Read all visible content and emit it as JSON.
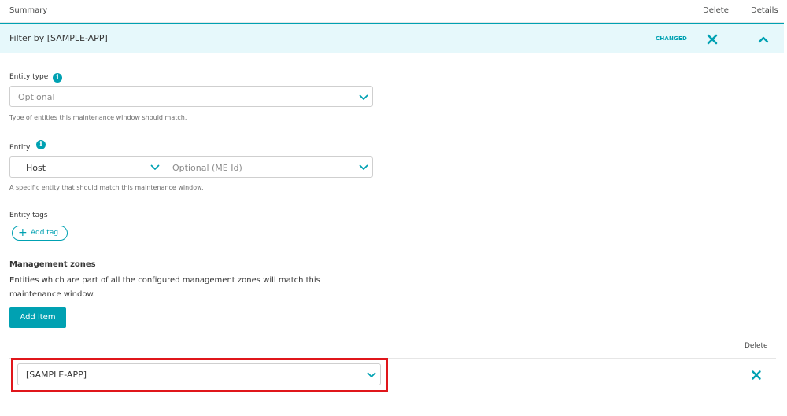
{
  "header": {
    "summary": "Summary",
    "delete": "Delete",
    "details": "Details"
  },
  "filter_row": {
    "title": "Filter by [SAMPLE-APP]",
    "status": "CHANGED"
  },
  "entity_type": {
    "label": "Entity type",
    "value": "Optional",
    "hint": "Type of entities this maintenance window should match."
  },
  "entity": {
    "label": "Entity",
    "type_value": "Host",
    "id_placeholder": "Optional (ME Id)",
    "hint": "A specific entity that should match this maintenance window."
  },
  "entity_tags": {
    "label": "Entity tags",
    "add_tag": "Add tag"
  },
  "management_zones": {
    "title": "Management zones",
    "description": "Entities which are part of all the configured management zones will match this maintenance window.",
    "add_item": "Add item",
    "delete_header": "Delete",
    "items": [
      {
        "value": "[SAMPLE-APP]"
      }
    ]
  },
  "colors": {
    "accent": "#00a1b2",
    "highlight": "#e0161b",
    "row_bg": "#e6f8fb"
  }
}
